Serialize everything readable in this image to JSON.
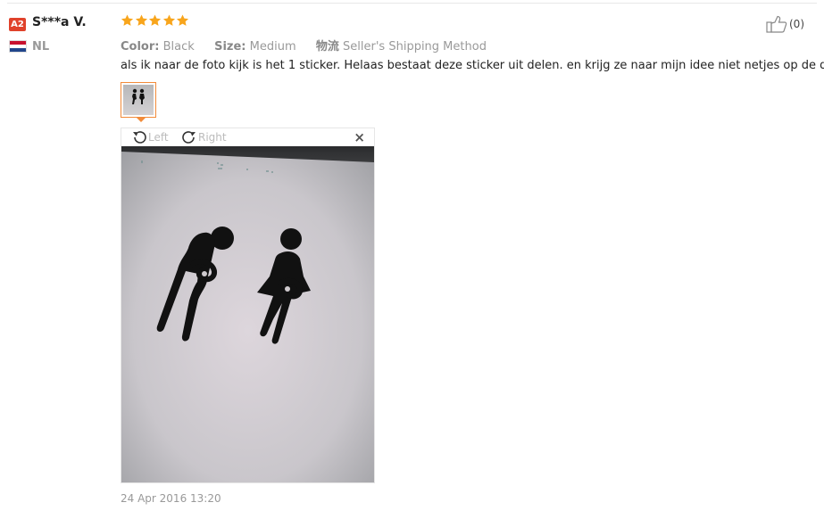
{
  "reviewer": {
    "level_badge": "A2",
    "name": "S***a V.",
    "country_code": "NL",
    "flag_colors": [
      "#c8102e",
      "#ffffff",
      "#21468b"
    ]
  },
  "rating": {
    "stars": 5,
    "max": 5,
    "color": "#f8a51c"
  },
  "attributes": {
    "color_label": "Color:",
    "color_value": "Black",
    "size_label": "Size:",
    "size_value": "Medium",
    "shipping_label": "物流",
    "shipping_value": "Seller's Shipping Method"
  },
  "feedback_text": "als ik naar de foto kijk is het 1 sticker. Helaas bestaat deze sticker uit delen. en krijg ze naar mijn idee niet netjes op de deur.",
  "image_viewer": {
    "rotate_left_label": "Left",
    "rotate_right_label": "Right",
    "close_symbol": "×"
  },
  "timestamp": "24 Apr 2016 13:20",
  "helpful": {
    "icon": "thumbs-up-icon",
    "count_label": "(0)"
  },
  "accent_color": "#f28b3a"
}
